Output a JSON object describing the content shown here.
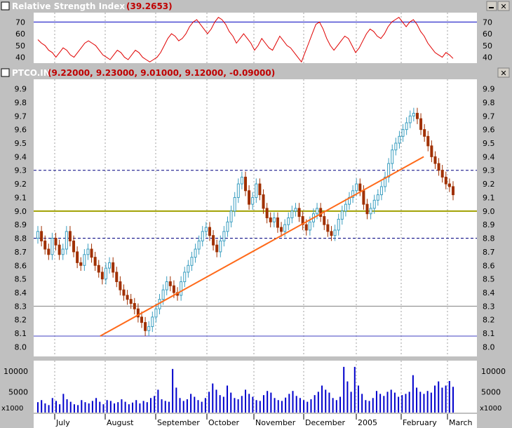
{
  "rsi_pane": {
    "title": "Relative Strength Index",
    "value": "(39.2653)",
    "ticks": [
      "40",
      "50",
      "60",
      "70"
    ]
  },
  "price_pane": {
    "title": "PTCO.IN",
    "ohlc": "(9.22000, 9.23000, 9.01000, 9.12000, -0.09000)",
    "ticks": [
      "8.0",
      "8.1",
      "8.2",
      "8.3",
      "8.4",
      "8.5",
      "8.6",
      "8.7",
      "8.8",
      "8.9",
      "9.0",
      "9.1",
      "9.2",
      "9.3",
      "9.4",
      "9.5",
      "9.6",
      "9.7",
      "9.8",
      "9.9"
    ]
  },
  "volume_pane": {
    "ticks": [
      "5000",
      "10000"
    ],
    "unit": "x1000"
  },
  "x_axis": {
    "months": [
      "July",
      "August",
      "September",
      "October",
      "November",
      "December",
      "2005",
      "February",
      "March"
    ]
  },
  "colors": {
    "background": "#ffffff",
    "title_bar": "#c0c0c0",
    "title_text": "#ffffff",
    "title_value": "#c00000",
    "rsi_line": "#e00000",
    "rsi_level": "#0000c0",
    "up_candle": "#3a9ec0",
    "down_candle": "#a03000",
    "trendline": "#ff6a1a",
    "support_9_0": "#a0a000",
    "resistance_dashed": "#000080",
    "grey_line": "#808080",
    "blue_line": "#4040c0",
    "volume_bar": "#0000cc"
  },
  "chart_data": [
    {
      "type": "line",
      "title": "Relative Strength Index",
      "value_label": "(39.2653)",
      "ylim": [
        35,
        78
      ],
      "reference_lines": [
        70
      ],
      "y": [
        55,
        52,
        50,
        46,
        44,
        40,
        44,
        48,
        46,
        42,
        40,
        44,
        48,
        52,
        54,
        52,
        50,
        46,
        42,
        40,
        38,
        42,
        46,
        44,
        40,
        38,
        42,
        46,
        44,
        40,
        38,
        36,
        38,
        40,
        44,
        50,
        56,
        60,
        58,
        54,
        56,
        60,
        66,
        70,
        72,
        68,
        64,
        60,
        64,
        70,
        74,
        72,
        68,
        62,
        58,
        52,
        56,
        60,
        56,
        52,
        46,
        50,
        56,
        52,
        48,
        46,
        52,
        58,
        54,
        50,
        48,
        44,
        40,
        36,
        44,
        52,
        60,
        68,
        70,
        64,
        56,
        50,
        46,
        50,
        54,
        58,
        56,
        50,
        44,
        48,
        54,
        60,
        64,
        62,
        58,
        56,
        60,
        66,
        70,
        72,
        74,
        70,
        66,
        70,
        72,
        68,
        62,
        58,
        52,
        48,
        44,
        42,
        40,
        44,
        42,
        39
      ]
    },
    {
      "type": "candlestick",
      "title": "PTCO.IN",
      "ylim": [
        7.93,
        9.97
      ],
      "x_labels": [
        "July",
        "August",
        "September",
        "October",
        "November",
        "December",
        "2005",
        "February",
        "March"
      ],
      "horizontal_lines": [
        {
          "y": 9.3,
          "style": "dashed"
        },
        {
          "y": 9.0,
          "style": "solid"
        },
        {
          "y": 8.8,
          "style": "dashed"
        },
        {
          "y": 8.3,
          "style": "solid"
        },
        {
          "y": 8.08,
          "style": "solid"
        }
      ],
      "trendline": {
        "from": [
          8.08,
          0.15
        ],
        "to": [
          9.4,
          0.88
        ]
      },
      "close": [
        8.85,
        8.78,
        8.72,
        8.68,
        8.8,
        8.75,
        8.68,
        8.72,
        8.85,
        8.78,
        8.7,
        8.62,
        8.6,
        8.68,
        8.72,
        8.66,
        8.6,
        8.55,
        8.5,
        8.58,
        8.62,
        8.55,
        8.48,
        8.42,
        8.38,
        8.35,
        8.32,
        8.28,
        8.22,
        8.18,
        8.12,
        8.15,
        8.22,
        8.28,
        8.35,
        8.42,
        8.48,
        8.45,
        8.4,
        8.38,
        8.48,
        8.55,
        8.6,
        8.66,
        8.72,
        8.78,
        8.85,
        8.88,
        8.82,
        8.75,
        8.7,
        8.78,
        8.85,
        8.92,
        9.0,
        9.1,
        9.2,
        9.25,
        9.15,
        9.05,
        9.1,
        9.2,
        9.12,
        9.02,
        8.95,
        8.92,
        8.95,
        8.88,
        8.85,
        8.9,
        8.95,
        9.0,
        9.02,
        8.96,
        8.9,
        8.86,
        8.92,
        8.98,
        9.02,
        8.96,
        8.9,
        8.85,
        8.82,
        8.86,
        8.94,
        9.0,
        9.05,
        9.1,
        9.15,
        9.2,
        9.15,
        9.05,
        8.98,
        9.02,
        9.08,
        9.12,
        9.18,
        9.25,
        9.35,
        9.45,
        9.5,
        9.55,
        9.6,
        9.65,
        9.7,
        9.72,
        9.68,
        9.6,
        9.55,
        9.48,
        9.4,
        9.35,
        9.3,
        9.25,
        9.2,
        9.18,
        9.12
      ]
    },
    {
      "type": "bar",
      "title": "Volume",
      "unit": "x1000",
      "ylim": [
        0,
        12500
      ],
      "values": [
        2500,
        3000,
        2200,
        1800,
        3500,
        2800,
        2000,
        4500,
        3200,
        2600,
        2000,
        1800,
        3000,
        2500,
        2200,
        2800,
        3500,
        2600,
        2000,
        3000,
        2800,
        2200,
        2500,
        3200,
        2600,
        2000,
        2400,
        3000,
        2200,
        2800,
        2500,
        3500,
        4000,
        5500,
        3200,
        2800,
        2600,
        10500,
        6000,
        3500,
        2800,
        3200,
        4500,
        3800,
        3000,
        2600,
        3500,
        5000,
        7000,
        5500,
        4200,
        3800,
        6500,
        4800,
        3500,
        3200,
        4000,
        5500,
        4500,
        3800,
        3000,
        2800,
        4200,
        5200,
        4800,
        3500,
        3000,
        2800,
        3600,
        4500,
        5200,
        4000,
        3500,
        3000,
        2600,
        3200,
        4200,
        5000,
        6500,
        5500,
        4800,
        3500,
        3000,
        3800,
        11000,
        7500,
        5000,
        11000,
        6500,
        4500,
        3000,
        2800,
        3500,
        5200,
        4500,
        4000,
        5000,
        5500,
        4800,
        3800,
        4200,
        4500,
        5000,
        9000,
        6000,
        5000,
        4500,
        5200,
        4800,
        6500,
        7500,
        6000,
        6500,
        7600,
        6200
      ]
    }
  ]
}
